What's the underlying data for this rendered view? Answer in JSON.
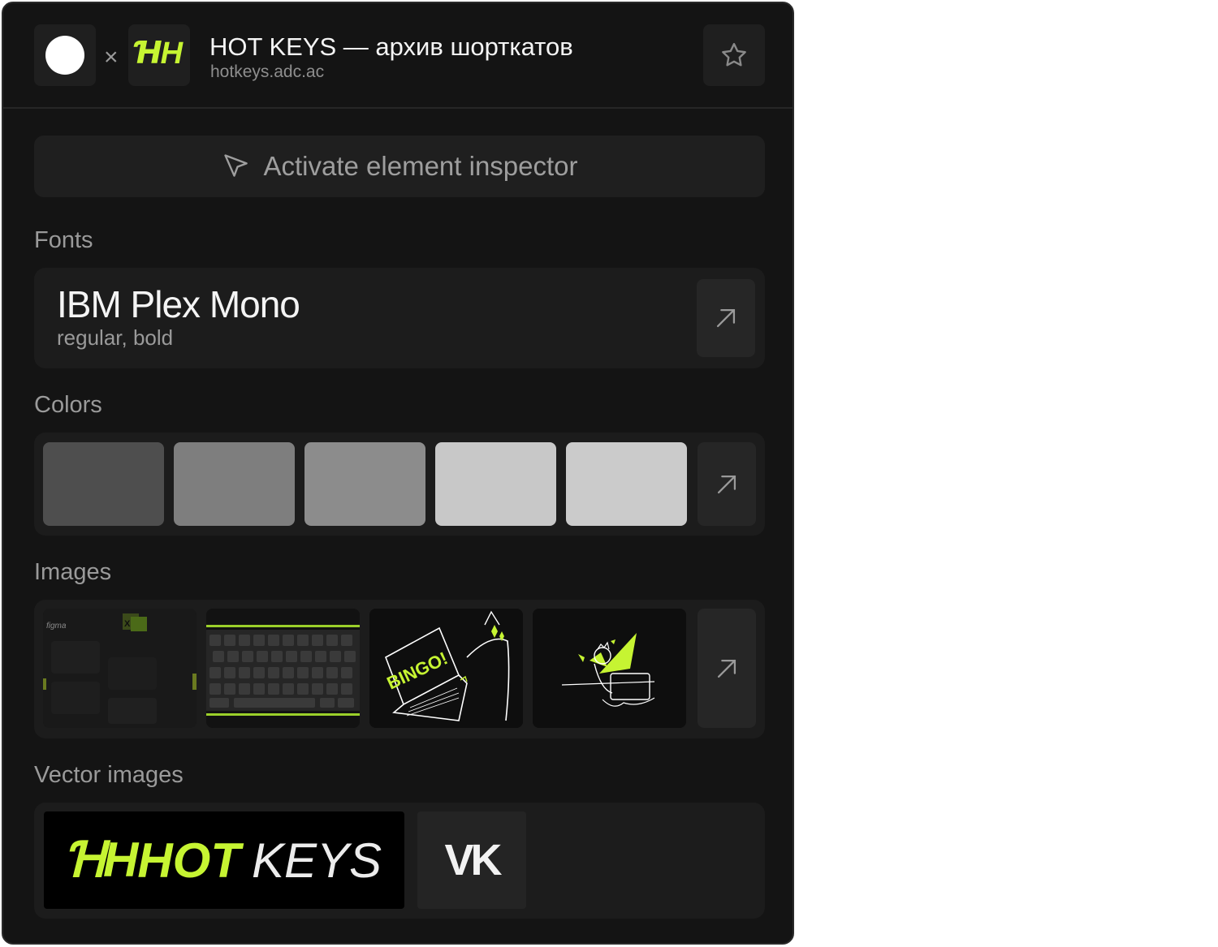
{
  "header": {
    "separator": "×",
    "logo_mark": "ꞪH",
    "title": "HOT KEYS — архив шорткатов",
    "url": "hotkeys.adc.ac",
    "favorite_icon": "star-icon"
  },
  "inspector": {
    "label": "Activate element inspector",
    "icon": "cursor-icon"
  },
  "fonts": {
    "section_label": "Fonts",
    "items": [
      {
        "name": "IBM Plex Mono",
        "weights": "regular, bold"
      }
    ]
  },
  "colors": {
    "section_label": "Colors",
    "swatches": [
      "#4e4e4e",
      "#7e7e7e",
      "#8c8c8c",
      "#c8c8c8",
      "#cbcbcb"
    ]
  },
  "images": {
    "section_label": "Images",
    "thumb_caption": "figma",
    "bingo_text": "BINGO!",
    "accent": "#c6f432"
  },
  "vector_images": {
    "section_label": "Vector images",
    "logo_mark": "ꞪH",
    "logo_word": "HOT",
    "logo_word2": "KEYS",
    "vk_label": "VK"
  }
}
